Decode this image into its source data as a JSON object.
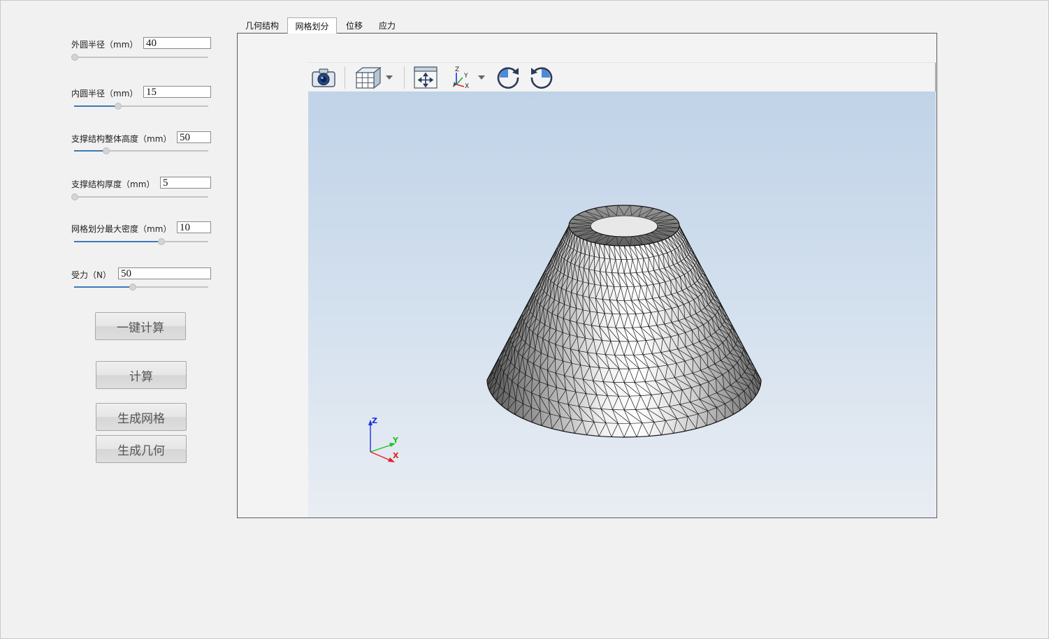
{
  "params": [
    {
      "label": "外圆半径（mm）",
      "value": "40",
      "slider_fraction": 0.0
    },
    {
      "label": "内圆半径（mm）",
      "value": "15",
      "slider_fraction": 0.33
    },
    {
      "label": "支撑结构整体高度（mm）",
      "value": "50",
      "slider_fraction": 0.24
    },
    {
      "label": "支撑结构厚度（mm）",
      "value": "5",
      "slider_fraction": 0.0
    },
    {
      "label": "网格划分最大密度（mm）",
      "value": "10",
      "slider_fraction": 0.65
    },
    {
      "label": "受力（N）",
      "value": "50",
      "slider_fraction": 0.44
    }
  ],
  "buttons": {
    "one_click": "一键计算",
    "compute": "计算",
    "gen_mesh": "生成网格",
    "gen_geometry": "生成几何"
  },
  "tabs": [
    {
      "label": "几何结构",
      "active": false
    },
    {
      "label": "网格划分",
      "active": true
    },
    {
      "label": "位移",
      "active": false
    },
    {
      "label": "应力",
      "active": false
    }
  ],
  "toolbar": [
    {
      "icon": "camera-icon"
    },
    {
      "icon": "mesh-view-cube-icon",
      "dropdown": true
    },
    {
      "icon": "fit-view-icon"
    },
    {
      "icon": "axes-orientation-icon",
      "dropdown": true
    },
    {
      "icon": "rotate-clockwise-icon"
    },
    {
      "icon": "rotate-counterclockwise-icon"
    }
  ],
  "triad": {
    "x": "X",
    "y": "Y",
    "z": "Z",
    "x_color": "#e02020",
    "y_color": "#20c020",
    "z_color": "#2030e0"
  },
  "colors": {
    "slider_fill": "#3a7ab8",
    "viewport_top": "#c0d3e8",
    "viewport_bottom": "#e9edf3"
  }
}
